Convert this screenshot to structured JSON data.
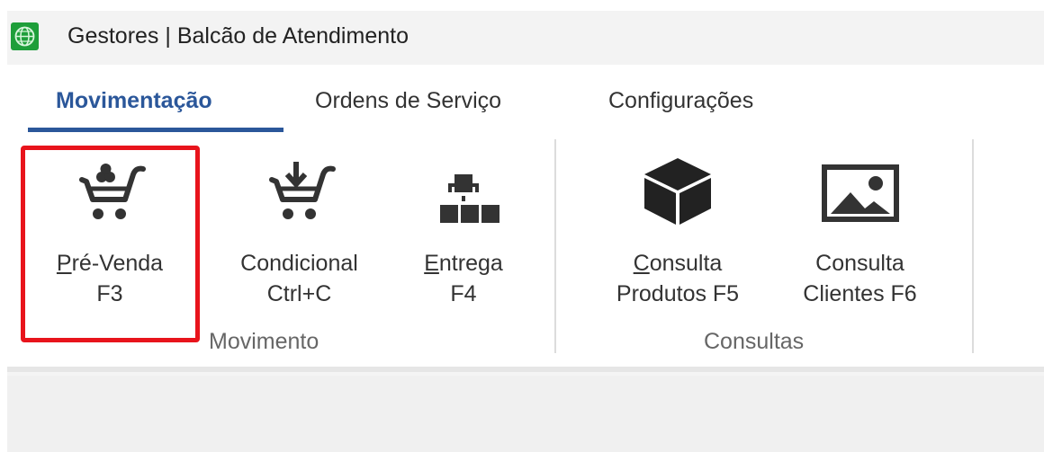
{
  "window": {
    "app_name": "Gestores",
    "separator": "|",
    "screen_title": "Balcão de Atendimento",
    "icon": "globe-app-icon"
  },
  "tabs": [
    {
      "label": "Movimentação",
      "active": true
    },
    {
      "label": "Ordens de Serviço",
      "active": false
    },
    {
      "label": "Configurações",
      "active": false
    }
  ],
  "groups": {
    "movimento": {
      "label": "Movimento",
      "items": [
        {
          "line1_hotkey": "P",
          "line1_rest": "ré-Venda",
          "line2": "F3",
          "icon": "shopping-cart-icon",
          "highlighted": true
        },
        {
          "line1": "Condicional",
          "line2": "Ctrl+C",
          "icon": "cart-download-icon"
        },
        {
          "line1_hotkey": "E",
          "line1_rest": "ntrega",
          "line2": "F4",
          "icon": "delivery-boxes-icon"
        }
      ]
    },
    "consultas": {
      "label": "Consultas",
      "items": [
        {
          "line1_hotkey": "C",
          "line1_rest": "onsulta",
          "line2": "Produtos F5",
          "icon": "product-box-icon"
        },
        {
          "line1": "Consulta",
          "line2": "Clientes F6",
          "icon": "image-picture-icon"
        }
      ]
    }
  },
  "colors": {
    "accent": "#2b579a",
    "highlight_border": "#e8141c",
    "app_icon": "#1e9e3a"
  }
}
